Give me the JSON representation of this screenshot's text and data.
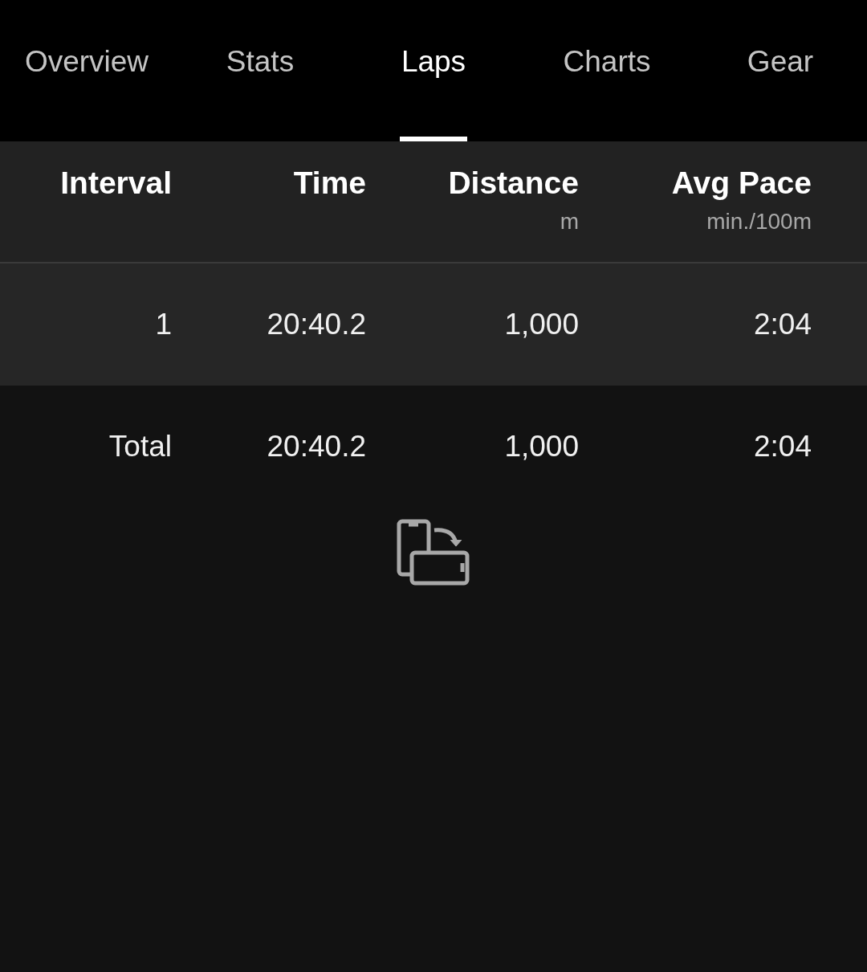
{
  "tabs": [
    {
      "label": "Overview",
      "selected": false
    },
    {
      "label": "Stats",
      "selected": false
    },
    {
      "label": "Laps",
      "selected": true
    },
    {
      "label": "Charts",
      "selected": false
    },
    {
      "label": "Gear",
      "selected": false
    }
  ],
  "table": {
    "columns": [
      {
        "label": "Interval"
      },
      {
        "label": "Time"
      },
      {
        "label": "Distance",
        "unit": "m"
      },
      {
        "label": "Avg Pace",
        "unit": "min./100m"
      }
    ],
    "rows": [
      [
        "1",
        "20:40.2",
        "1,000",
        "2:04"
      ]
    ],
    "total": [
      "Total",
      "20:40.2",
      "1,000",
      "2:04"
    ]
  }
}
